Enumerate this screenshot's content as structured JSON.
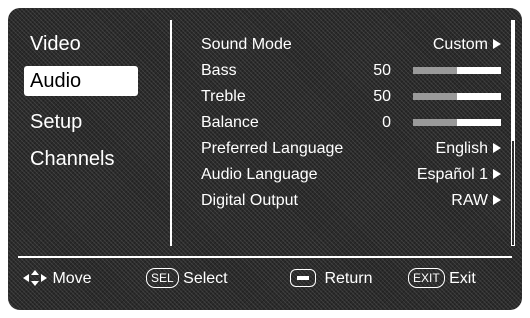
{
  "sidebar": {
    "items": [
      {
        "label": "Video"
      },
      {
        "label": "Audio",
        "selected": true
      },
      {
        "label": "Setup"
      },
      {
        "label": "Channels"
      }
    ]
  },
  "settings": {
    "sound_mode": {
      "label": "Sound Mode",
      "value": "Custom"
    },
    "bass": {
      "label": "Bass",
      "value": "50",
      "level": 0.5
    },
    "treble": {
      "label": "Treble",
      "value": "50",
      "level": 0.5
    },
    "balance": {
      "label": "Balance",
      "value": "0",
      "level": 0.5
    },
    "preferred_language": {
      "label": "Preferred Language",
      "value": "English"
    },
    "audio_language": {
      "label": "Audio Language",
      "value": "Español 1"
    },
    "digital_output": {
      "label": "Digital Output",
      "value": "RAW"
    }
  },
  "footer": {
    "move": "Move",
    "sel_key": "SEL",
    "select": "Select",
    "return": "Return",
    "exit_key": "EXIT",
    "exit": "Exit"
  },
  "icons": {
    "move": "dpad-icon",
    "return": "return-key-icon",
    "submenu": "triangle-right-icon"
  },
  "colors": {
    "background": "#2b2b2b",
    "text": "#ffffff",
    "selected_bg": "#ffffff",
    "selected_text": "#000000",
    "slider_fill": "#9a9a9a"
  }
}
